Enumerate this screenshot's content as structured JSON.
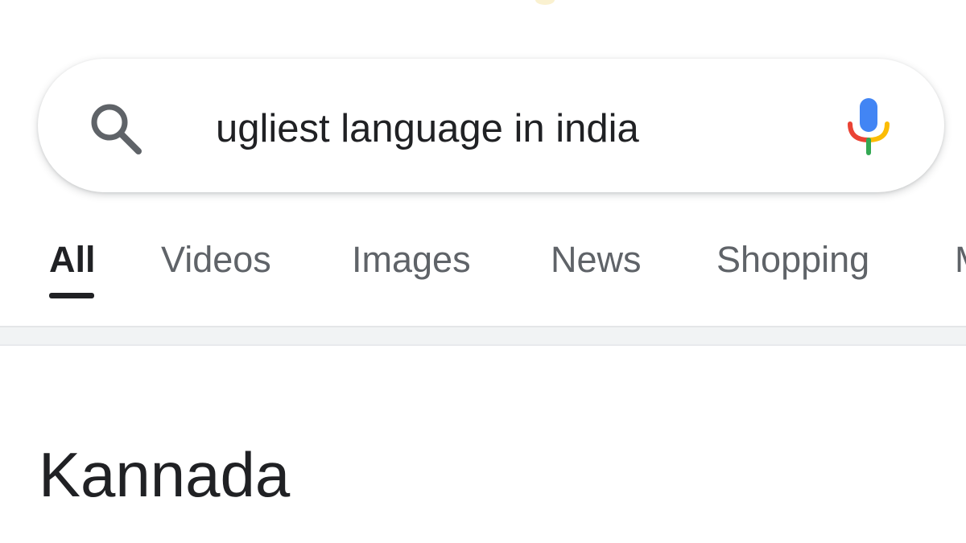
{
  "search": {
    "query": "ugliest language in india",
    "icon": "search-icon",
    "voice_icon": "mic-icon"
  },
  "tabs": [
    {
      "label": "All",
      "active": true
    },
    {
      "label": "Videos",
      "active": false
    },
    {
      "label": "Images",
      "active": false
    },
    {
      "label": "News",
      "active": false
    },
    {
      "label": "Shopping",
      "active": false
    },
    {
      "label": "M",
      "active": false
    }
  ],
  "result": {
    "answer": "Kannada"
  },
  "colors": {
    "text_primary": "#202124",
    "text_secondary": "#5f6368",
    "mic_blue": "#4285f4",
    "mic_red": "#ea4335",
    "mic_yellow": "#fbbc05",
    "mic_green": "#34a853",
    "divider": "#f1f3f4"
  }
}
